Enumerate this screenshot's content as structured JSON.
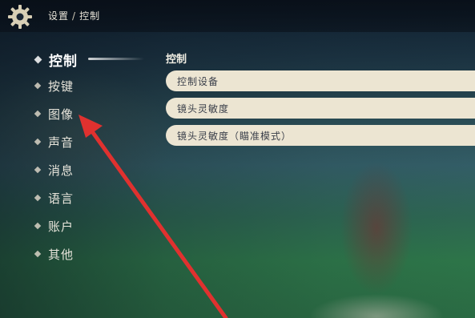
{
  "breadcrumb": {
    "parent": "设置",
    "separator": "/",
    "current": "控制"
  },
  "sidebar": {
    "items": [
      {
        "label": "控制",
        "active": true
      },
      {
        "label": "按键",
        "active": false
      },
      {
        "label": "图像",
        "active": false
      },
      {
        "label": "声音",
        "active": false
      },
      {
        "label": "消息",
        "active": false
      },
      {
        "label": "语言",
        "active": false
      },
      {
        "label": "账户",
        "active": false
      },
      {
        "label": "其他",
        "active": false
      }
    ]
  },
  "main": {
    "section_title": "控制",
    "rows": [
      {
        "label": "控制设备"
      },
      {
        "label": "镜头灵敏度"
      },
      {
        "label": "镜头灵敏度（瞄准模式）"
      }
    ]
  },
  "annotation": {
    "arrow_color": "#e0312f",
    "target": "图像"
  },
  "icons": {
    "settings": "gear-icon"
  }
}
